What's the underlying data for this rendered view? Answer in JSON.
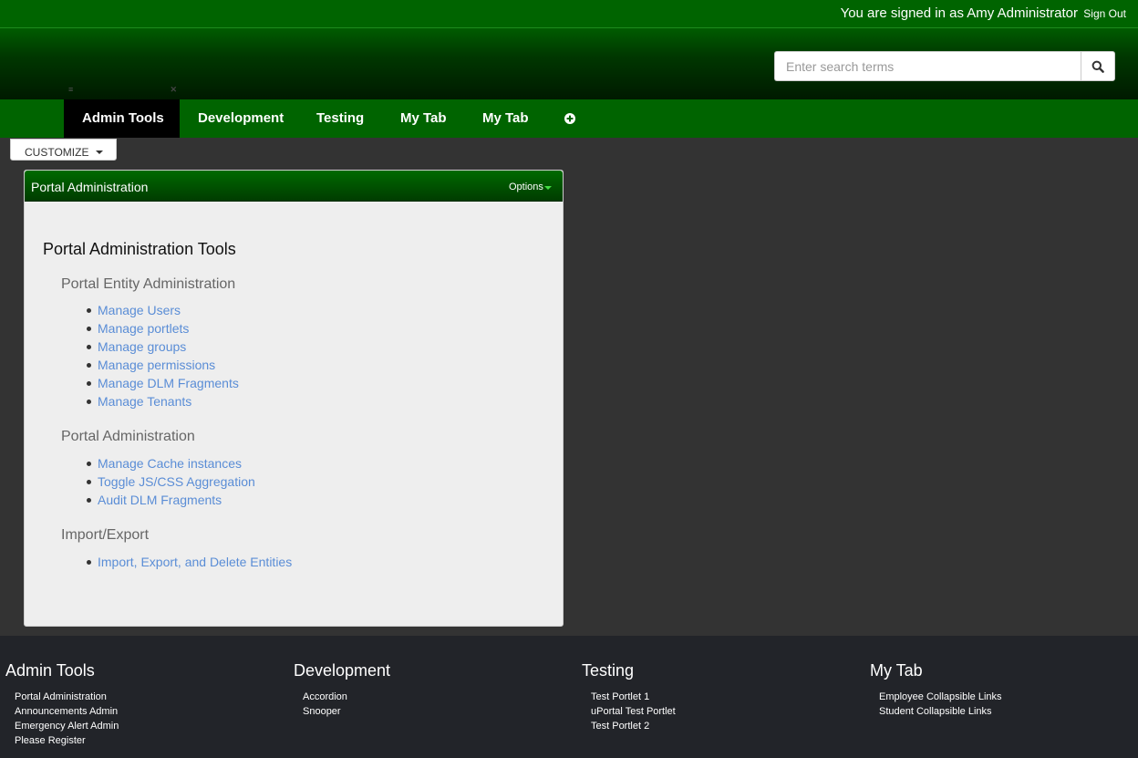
{
  "topbar": {
    "signed_in_text": "You are signed in as Amy Administrator",
    "sign_out_label": "Sign Out"
  },
  "search": {
    "placeholder": "Enter search terms",
    "icon": "search-icon"
  },
  "nav": {
    "tabs": [
      {
        "label": "Admin Tools",
        "active": true
      },
      {
        "label": "Development",
        "active": false
      },
      {
        "label": "Testing",
        "active": false
      },
      {
        "label": "My Tab",
        "active": false
      },
      {
        "label": "My Tab",
        "active": false
      }
    ],
    "add_tab_icon": "plus-circle-icon"
  },
  "customize": {
    "label": "CUSTOMIZE"
  },
  "portlet": {
    "title": "Portal Administration",
    "options_label": "Options",
    "heading": "Portal Administration Tools",
    "sections": [
      {
        "title": "Portal Entity Administration",
        "links": [
          "Manage Users",
          "Manage portlets",
          "Manage groups",
          "Manage permissions",
          "Manage DLM Fragments",
          "Manage Tenants"
        ]
      },
      {
        "title": "Portal Administration",
        "links": [
          "Manage Cache instances",
          "Toggle JS/CSS Aggregation",
          "Audit DLM Fragments"
        ]
      },
      {
        "title": "Import/Export",
        "links": [
          "Import, Export, and Delete Entities"
        ]
      }
    ]
  },
  "footer": {
    "columns": [
      {
        "title": "Admin Tools",
        "items": [
          "Portal Administration",
          "Announcements Admin",
          "Emergency Alert Admin",
          "Please Register"
        ]
      },
      {
        "title": "Development",
        "items": [
          "Accordion",
          "Snooper"
        ]
      },
      {
        "title": "Testing",
        "items": [
          "Test Portlet 1",
          "uPortal Test Portlet",
          "Test Portlet 2"
        ]
      },
      {
        "title": "My Tab",
        "items": [
          "Employee Collapsible Links",
          "Student Collapsible Links"
        ]
      }
    ]
  },
  "colors": {
    "brand_green": "#006400",
    "link_blue": "#5a8dd6",
    "footer_bg": "#222429",
    "page_bg": "#333333"
  }
}
